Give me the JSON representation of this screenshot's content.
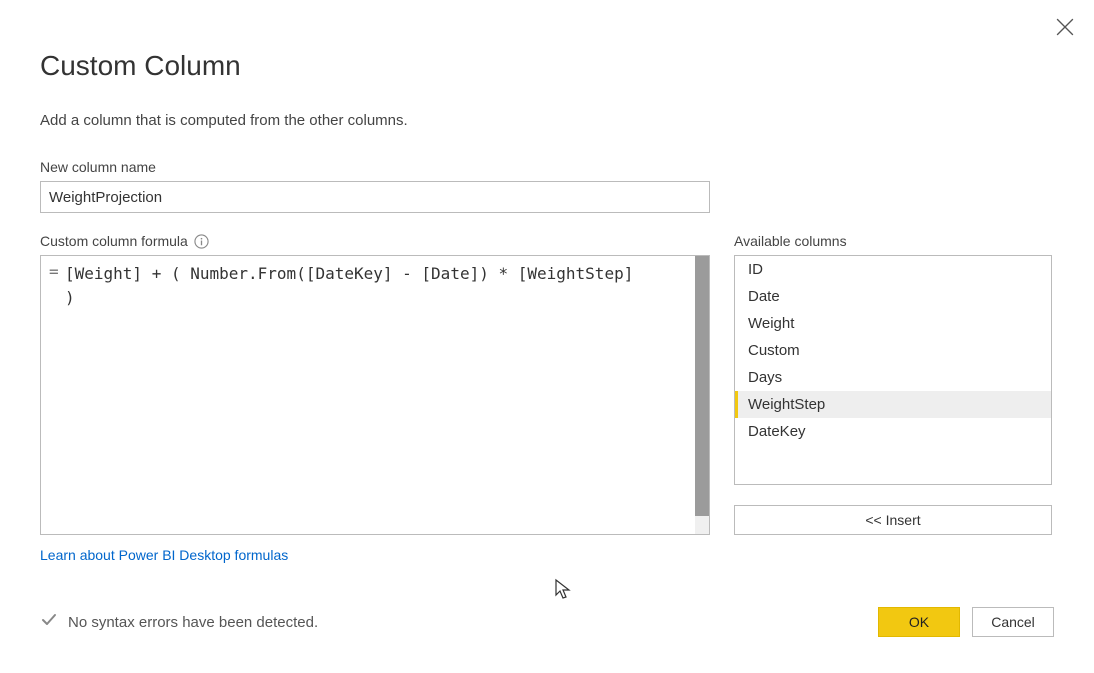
{
  "dialog": {
    "title": "Custom Column",
    "subtitle": "Add a column that is computed from the other columns.",
    "close_label": "Close"
  },
  "column_name": {
    "label": "New column name",
    "value": "WeightProjection"
  },
  "formula": {
    "label": "Custom column formula",
    "prefix": "=",
    "value": "[Weight] + ( Number.From([DateKey] - [Date]) * [WeightStep]\n)"
  },
  "available": {
    "label": "Available columns",
    "items": [
      {
        "name": "ID",
        "selected": false
      },
      {
        "name": "Date",
        "selected": false
      },
      {
        "name": "Weight",
        "selected": false
      },
      {
        "name": "Custom",
        "selected": false
      },
      {
        "name": "Days",
        "selected": false
      },
      {
        "name": "WeightStep",
        "selected": true
      },
      {
        "name": "DateKey",
        "selected": false
      }
    ],
    "insert_label": "<< Insert"
  },
  "link": {
    "text": "Learn about Power BI Desktop formulas"
  },
  "status": {
    "message": "No syntax errors have been detected."
  },
  "buttons": {
    "ok": "OK",
    "cancel": "Cancel"
  }
}
